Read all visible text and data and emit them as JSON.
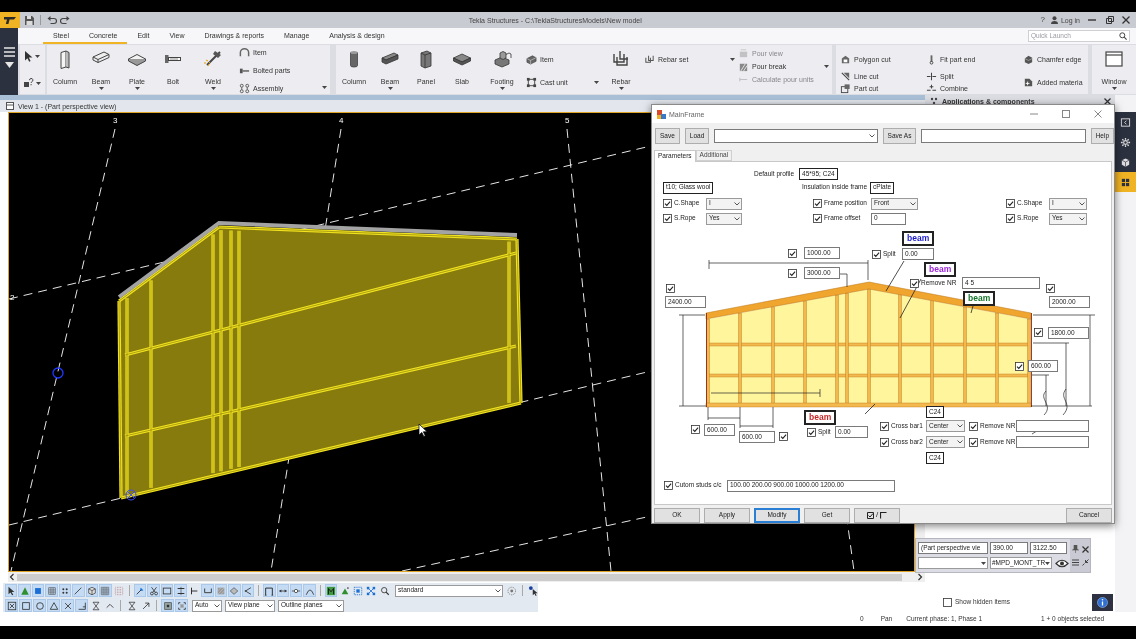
{
  "title_bar": {
    "title": "Tekla Structures - C:\\TeklaStructuresModels\\New model",
    "help": "?",
    "login": "Log in"
  },
  "menu_tabs": [
    {
      "label": "Steel",
      "selected": true
    },
    {
      "label": "Concrete",
      "selected": true
    },
    {
      "label": "Edit",
      "selected": false
    },
    {
      "label": "View",
      "selected": false
    },
    {
      "label": "Drawings & reports",
      "selected": false
    },
    {
      "label": "Manage",
      "selected": false
    },
    {
      "label": "Analysis & design",
      "selected": false
    }
  ],
  "quick_launch": {
    "placeholder": "Quick Launch"
  },
  "ribbon": {
    "steel": {
      "large": [
        {
          "kind": "icolumn",
          "label": "Column",
          "menu": false
        },
        {
          "kind": "ibeam",
          "label": "Beam",
          "menu": true
        },
        {
          "kind": "plate",
          "label": "Plate",
          "menu": true
        },
        {
          "kind": "bolt",
          "label": "Bolt",
          "menu": false
        },
        {
          "kind": "weld",
          "label": "Weld",
          "menu": true
        }
      ],
      "small": [
        {
          "kind": "arch",
          "label": "Item"
        },
        {
          "kind": "bolted",
          "label": "Bolted parts"
        },
        {
          "kind": "assembly",
          "label": "Assembly"
        }
      ]
    },
    "concrete": {
      "large": [
        {
          "kind": "cylinder",
          "label": "Column",
          "menu": false
        },
        {
          "kind": "bar",
          "label": "Beam",
          "menu": true
        },
        {
          "kind": "panel",
          "label": "Panel",
          "menu": false
        },
        {
          "kind": "slab",
          "label": "Slab",
          "menu": false
        },
        {
          "kind": "footing",
          "label": "Footing",
          "menu": true
        }
      ],
      "small": [
        {
          "kind": "brick",
          "label": "Item",
          "menu": false
        },
        {
          "kind": "castunit",
          "label": "Cast unit",
          "menu": true
        }
      ]
    },
    "rebar": {
      "kind": "rebar",
      "label": "Rebar",
      "menu": true
    },
    "rebar_tools": [
      {
        "kind": "rebarset",
        "label": "Rebar set",
        "menu": true
      }
    ],
    "pour": [
      {
        "kind": "pourview",
        "label": "Pour view",
        "disabled": true,
        "menu": false
      },
      {
        "kind": "pourbreak",
        "label": "Pour break",
        "disabled": false,
        "menu": true
      },
      {
        "kind": "calcpour",
        "label": "Calculate pour units",
        "disabled": true,
        "menu": false
      }
    ],
    "edit": [
      [
        {
          "kind": "polygoncut",
          "label": "Polygon cut"
        },
        {
          "kind": "linecut",
          "label": "Line cut"
        },
        {
          "kind": "partcut",
          "label": "Part cut"
        }
      ],
      [
        {
          "kind": "fitend",
          "label": "Fit part end"
        },
        {
          "kind": "split",
          "label": "Split"
        },
        {
          "kind": "combine",
          "label": "Combine"
        }
      ],
      [
        {
          "kind": "chamfer",
          "label": "Chamfer edge"
        },
        {
          "kind": "addedmat",
          "label": "Added materia"
        }
      ]
    ],
    "window": {
      "kind": "window",
      "label": "Window",
      "menu": true
    }
  },
  "view": {
    "title": "View 1 - (Part perspective view)",
    "grid_labels": [
      "3",
      "4",
      "5",
      "2"
    ]
  },
  "side_panel": {
    "title": "Applications & components",
    "show_hidden": {
      "label": "Show hidden items",
      "checked": false
    }
  },
  "side_tabs": [
    {
      "kind": "panelarrow",
      "selected": false
    },
    {
      "kind": "gear",
      "selected": false
    },
    {
      "kind": "cube",
      "selected": false
    },
    {
      "kind": "apps",
      "selected": true
    }
  ],
  "coordinate_bar": {
    "view": "(Part perspective vie",
    "values": [
      "390.00",
      "3122.50"
    ],
    "filter": "#MPD_MONT_TR"
  },
  "dialog": {
    "title": "MainFrame",
    "toolbar": [
      {
        "kind": "button",
        "label": "Save"
      },
      {
        "kind": "button",
        "label": "Load"
      },
      {
        "kind": "dropdown"
      },
      {
        "kind": "button",
        "label": "Save As"
      },
      {
        "kind": "field"
      },
      {
        "kind": "button",
        "label": "Help"
      }
    ],
    "tabs": [
      {
        "label": "Parameters",
        "selected": true
      },
      {
        "label": "Additional",
        "selected": false
      }
    ],
    "default_profile": {
      "label": "Default profile",
      "value": "45*95; C24"
    },
    "insulation_material": "t10; Glass wool",
    "insulation": {
      "label": "Insulation inside frame",
      "value": "cPlate"
    },
    "left_options": [
      {
        "label": "C.Shape",
        "checked": true,
        "value": "I"
      },
      {
        "label": "S.Rope",
        "checked": true,
        "value": "Yes"
      }
    ],
    "frame_options": [
      {
        "kind": "select",
        "label": "Frame position",
        "checked": true,
        "value": "Front"
      },
      {
        "kind": "input",
        "label": "Frame offset",
        "checked": true,
        "value": "0"
      }
    ],
    "right_options": [
      {
        "label": "C.Shape",
        "checked": true,
        "value": "I"
      },
      {
        "label": "S.Rope",
        "checked": true,
        "value": "Yes"
      }
    ],
    "diagram": {
      "beam_labels": [
        {
          "text": "beam",
          "color": "#1c1ccc"
        },
        {
          "text": "beam",
          "color": "#9b27d6"
        },
        {
          "text": "beam",
          "color": "#17752b"
        },
        {
          "text": "beam",
          "color": "#c62828"
        }
      ],
      "top_lengths": [
        {
          "checked": true,
          "value": "1000.00"
        },
        {
          "checked": true,
          "value": "3000.00"
        }
      ],
      "top_split": {
        "label": "Split",
        "checked": true,
        "value": "0.00"
      },
      "top_remove": {
        "label": "Remove NR",
        "checked": true,
        "value": "4 5"
      },
      "left_height": {
        "checked": true,
        "value": "2400.00"
      },
      "right_height": {
        "checked": true,
        "value": "2000.00"
      },
      "right_heights": [
        {
          "checked": true,
          "value": "1800.00"
        },
        {
          "checked": true,
          "value": "600.00"
        }
      ],
      "bottom_spacings": [
        {
          "checked": true,
          "value": "600.00"
        },
        {
          "checked": true,
          "value": "600.00"
        }
      ],
      "bottom_split": {
        "label": "Split",
        "checked": true,
        "value": "0.00"
      },
      "cross_bars": [
        {
          "label": "Cross bar1",
          "checked": true,
          "position": "Center",
          "remove_label": "Remove NR",
          "remove_checked": true
        },
        {
          "label": "Cross bar2",
          "checked": true,
          "position": "Center",
          "remove_label": "Remove NR",
          "remove_checked": true
        }
      ],
      "cross_bar_profiles": [
        "C24",
        "C24"
      ]
    },
    "custom_studs": {
      "label": "Cutom studs c/c",
      "checked": true,
      "value": "100.00 200.00 900.00 1000.00 1200.00"
    },
    "buttons": [
      {
        "kind": "text",
        "label": "OK",
        "focused": false
      },
      {
        "kind": "text",
        "label": "Apply",
        "focused": false
      },
      {
        "kind": "text",
        "label": "Modify",
        "focused": true
      },
      {
        "kind": "text",
        "label": "Get",
        "focused": false
      },
      {
        "kind": "toggle",
        "label": "/",
        "focused": false
      },
      {
        "kind": "text",
        "label": "Cancel",
        "focused": false
      }
    ]
  },
  "bottom_toolbar": {
    "row_1": [
      [
        {
          "kind": "pointer",
          "on": true
        },
        {
          "kind": "triangle",
          "on": true
        },
        {
          "kind": "square",
          "on": true
        },
        {
          "kind": "grid",
          "on": true
        },
        {
          "kind": "dots",
          "on": true
        },
        {
          "kind": "line",
          "on": true
        },
        {
          "kind": "cube",
          "on": true
        },
        {
          "kind": "mesh",
          "on": true
        },
        {
          "kind": "dotgrid",
          "on": false
        }
      ],
      [
        {
          "kind": "pick",
          "on": true
        },
        {
          "kind": "scissors",
          "on": true
        },
        {
          "kind": "rect",
          "on": true
        },
        {
          "kind": "align",
          "on": true
        },
        {
          "kind": "tee",
          "on": false
        },
        {
          "kind": "ucurve",
          "on": true
        },
        {
          "kind": "hatch",
          "on": true
        },
        {
          "kind": "diamond",
          "on": true
        },
        {
          "kind": "angle",
          "on": true
        }
      ],
      [
        {
          "kind": "bracket",
          "on": true
        },
        {
          "kind": "dimarrow",
          "on": true
        },
        {
          "kind": "nodeline",
          "on": true
        },
        {
          "kind": "arc",
          "on": true
        }
      ],
      [
        {
          "kind": "greenbox",
          "on": true
        },
        {
          "kind": "peak",
          "on": false
        },
        {
          "kind": "bluegrid",
          "on": false
        },
        {
          "kind": "crossnodes",
          "on": false
        },
        {
          "kind": "zoom",
          "on": false
        }
      ]
    ],
    "display_select": "standard",
    "row_2": [
      [
        {
          "kind": "squarex",
          "on": true
        },
        {
          "kind": "squareo",
          "on": true
        },
        {
          "kind": "circle",
          "on": true
        },
        {
          "kind": "trianglo",
          "on": true
        },
        {
          "kind": "xmark",
          "on": true
        },
        {
          "kind": "corner",
          "on": true
        },
        {
          "kind": "hourglass",
          "on": false
        },
        {
          "kind": "chevron",
          "on": false
        }
      ],
      [
        {
          "kind": "hourglass",
          "on": false
        },
        {
          "kind": "arrowup",
          "on": false
        }
      ],
      [
        {
          "kind": "squaredot",
          "on": true
        },
        {
          "kind": "squarecorners",
          "on": true
        }
      ]
    ],
    "selects": [
      "Auto",
      "View plane",
      "Outline planes"
    ]
  },
  "status_bar": [
    "0",
    "Pan",
    "Current phase: 1, Phase 1",
    "1 + 0 objects selected"
  ]
}
